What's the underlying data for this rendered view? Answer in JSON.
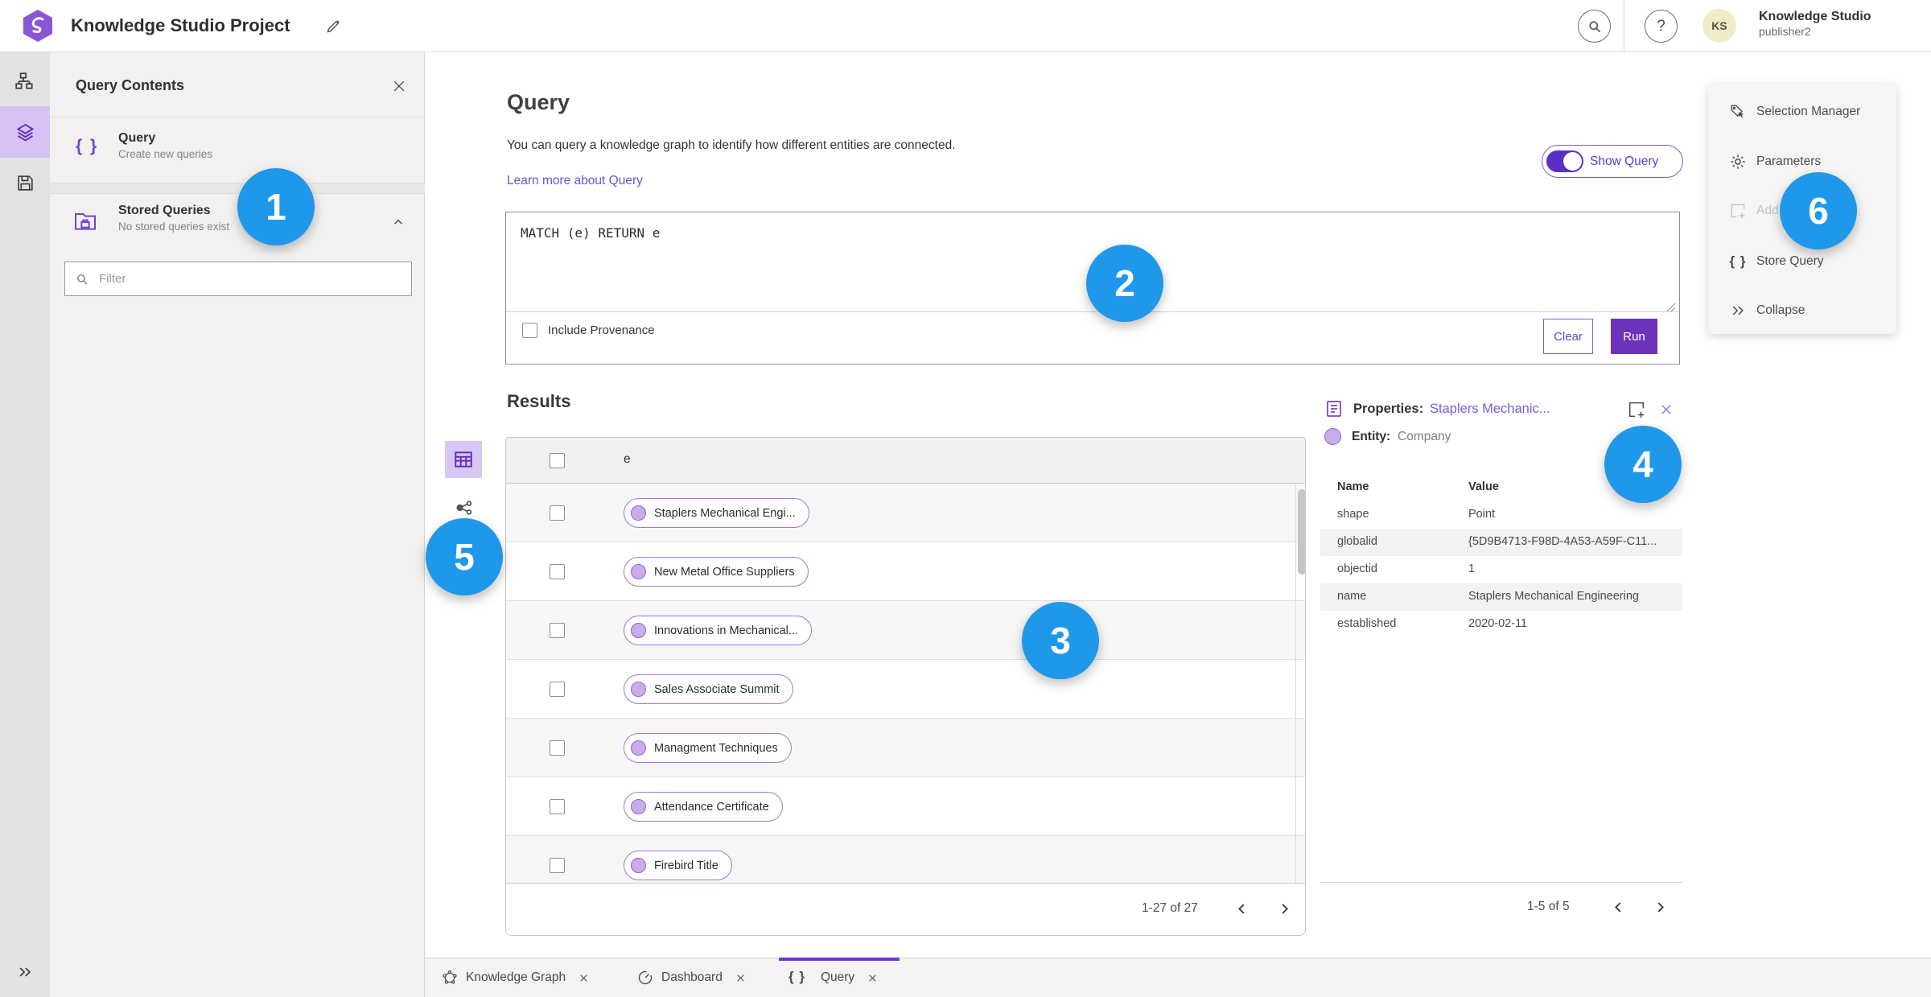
{
  "topbar": {
    "title": "Knowledge Studio Project",
    "user_name": "Knowledge Studio",
    "user_role": "publisher2",
    "avatar_initials": "KS",
    "help_glyph": "?"
  },
  "contents_panel": {
    "title": "Query Contents",
    "query_item": {
      "title": "Query",
      "subtitle": "Create new queries",
      "icon_glyph": "{ }"
    },
    "stored_item": {
      "title": "Stored Queries",
      "subtitle": "No stored queries exist"
    },
    "filter_placeholder": "Filter"
  },
  "query_section": {
    "heading": "Query",
    "description": "You can query a knowledge graph to identify how different entities are connected.",
    "learn_more": "Learn more about Query",
    "show_query_label": "Show Query",
    "query_text": "MATCH (e) RETURN e",
    "include_provenance_label": "Include Provenance",
    "clear_label": "Clear",
    "run_label": "Run"
  },
  "results": {
    "heading": "Results",
    "column_header": "e",
    "rows": [
      "Staplers Mechanical Engi...",
      "New Metal Office Suppliers",
      "Innovations in Mechanical...",
      "Sales Associate Summit",
      "Managment Techniques",
      "Attendance Certificate",
      "Firebird Title"
    ],
    "pagination": "1-27 of 27"
  },
  "properties": {
    "label": "Properties:",
    "entity_link": "Staplers Mechanic...",
    "entity_label": "Entity:",
    "entity_type": "Company",
    "col_name": "Name",
    "col_value": "Value",
    "rows": [
      {
        "name": "shape",
        "value": "Point"
      },
      {
        "name": "globalid",
        "value": "{5D9B4713-F98D-4A53-A59F-C11..."
      },
      {
        "name": "objectid",
        "value": "1"
      },
      {
        "name": "name",
        "value": "Staplers Mechanical Engineering"
      },
      {
        "name": "established",
        "value": "2020-02-11"
      }
    ],
    "pagination": "1-5 of 5"
  },
  "actions_menu": {
    "selection_manager": "Selection Manager",
    "parameters": "Parameters",
    "add": "Add",
    "store_query": "Store Query",
    "collapse": "Collapse",
    "brace_glyph": "{ }"
  },
  "tabs": [
    {
      "label": "Knowledge Graph"
    },
    {
      "label": "Dashboard"
    },
    {
      "label": "Query"
    }
  ],
  "annotations": {
    "c1": "1",
    "c2": "2",
    "c3": "3",
    "c4": "4",
    "c5": "5",
    "c6": "6"
  },
  "colors": {
    "accent_purple": "#6d32bb",
    "selection_purple": "#d6c2f5",
    "annotation_blue": "#1f98ea",
    "link_purple": "#6556ce"
  }
}
